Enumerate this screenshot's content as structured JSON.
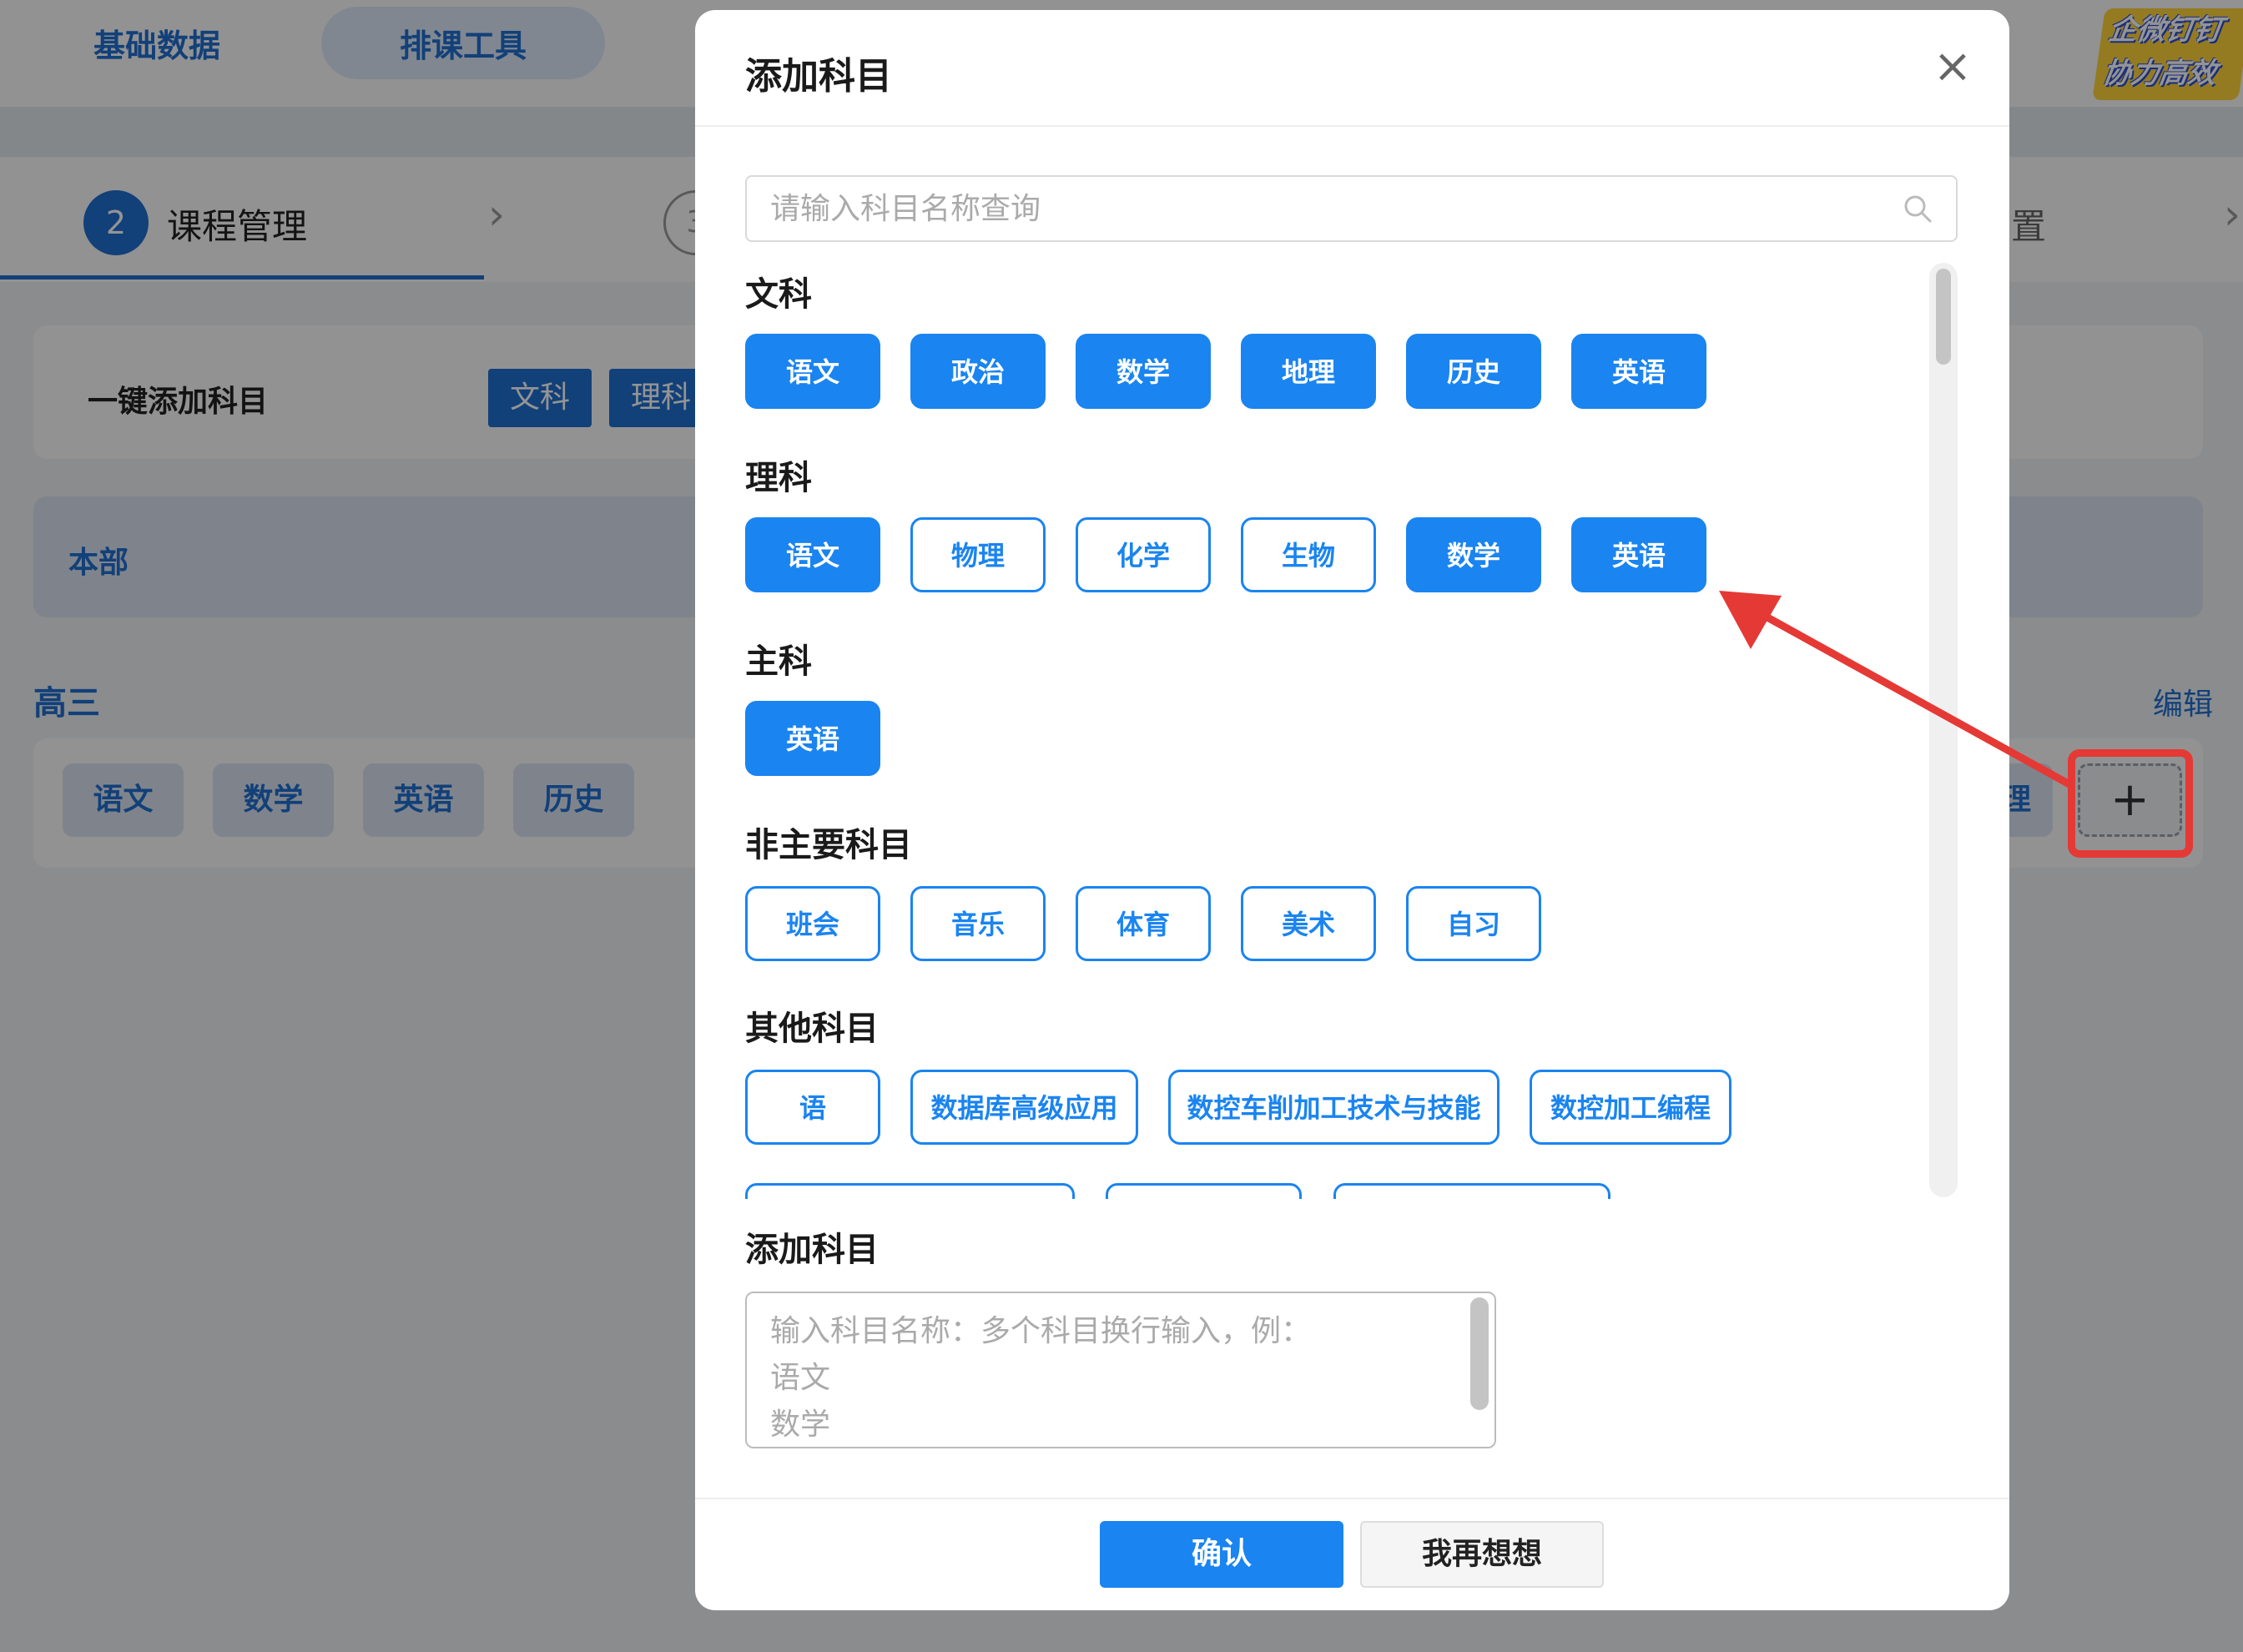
{
  "app": {
    "top_tabs": [
      "基础数据",
      "排课工具"
    ],
    "logo_lines": [
      "企微钉钉",
      "协力高效"
    ],
    "step": {
      "number": "2",
      "label": "课程管理",
      "next_number": "3",
      "next_label_partial": "置"
    },
    "quick_add": {
      "label": "一键添加科目",
      "buttons": [
        "文科",
        "理科"
      ]
    },
    "section_banner": "本部",
    "grade": {
      "title": "高三",
      "edit": "编辑",
      "subjects": [
        "语文",
        "数学",
        "英语",
        "历史"
      ],
      "partial_subject": "理",
      "add_button": "+"
    }
  },
  "modal": {
    "title": "添加科目",
    "close": "×",
    "search_placeholder": "请输入科目名称查询",
    "groups": [
      {
        "title": "文科",
        "items": [
          {
            "label": "语文",
            "selected": true
          },
          {
            "label": "政治",
            "selected": true
          },
          {
            "label": "数学",
            "selected": true
          },
          {
            "label": "地理",
            "selected": true
          },
          {
            "label": "历史",
            "selected": true
          },
          {
            "label": "英语",
            "selected": true
          }
        ]
      },
      {
        "title": "理科",
        "items": [
          {
            "label": "语文",
            "selected": true
          },
          {
            "label": "物理",
            "selected": false
          },
          {
            "label": "化学",
            "selected": false
          },
          {
            "label": "生物",
            "selected": false
          },
          {
            "label": "数学",
            "selected": true
          },
          {
            "label": "英语",
            "selected": true
          }
        ]
      },
      {
        "title": "主科",
        "items": [
          {
            "label": "英语",
            "selected": true
          }
        ]
      },
      {
        "title": "非主要科目",
        "items": [
          {
            "label": "班会",
            "selected": false
          },
          {
            "label": "音乐",
            "selected": false
          },
          {
            "label": "体育",
            "selected": false
          },
          {
            "label": "美术",
            "selected": false
          },
          {
            "label": "自习",
            "selected": false
          }
        ]
      },
      {
        "title": "其他科目",
        "items": [
          {
            "label": "语",
            "selected": false
          },
          {
            "label": "数据库高级应用",
            "selected": false
          },
          {
            "label": "数控车削加工技术与技能",
            "selected": false
          },
          {
            "label": "数控加工编程",
            "selected": false
          }
        ]
      }
    ],
    "add_section_title": "添加科目",
    "textarea_placeholder": "输入科目名称：多个科目换行输入，例：\n语文\n数学",
    "confirm": "确认",
    "cancel": "我再想想"
  },
  "colors": {
    "accent": "#1a84f0",
    "annotation": "#e53935"
  }
}
